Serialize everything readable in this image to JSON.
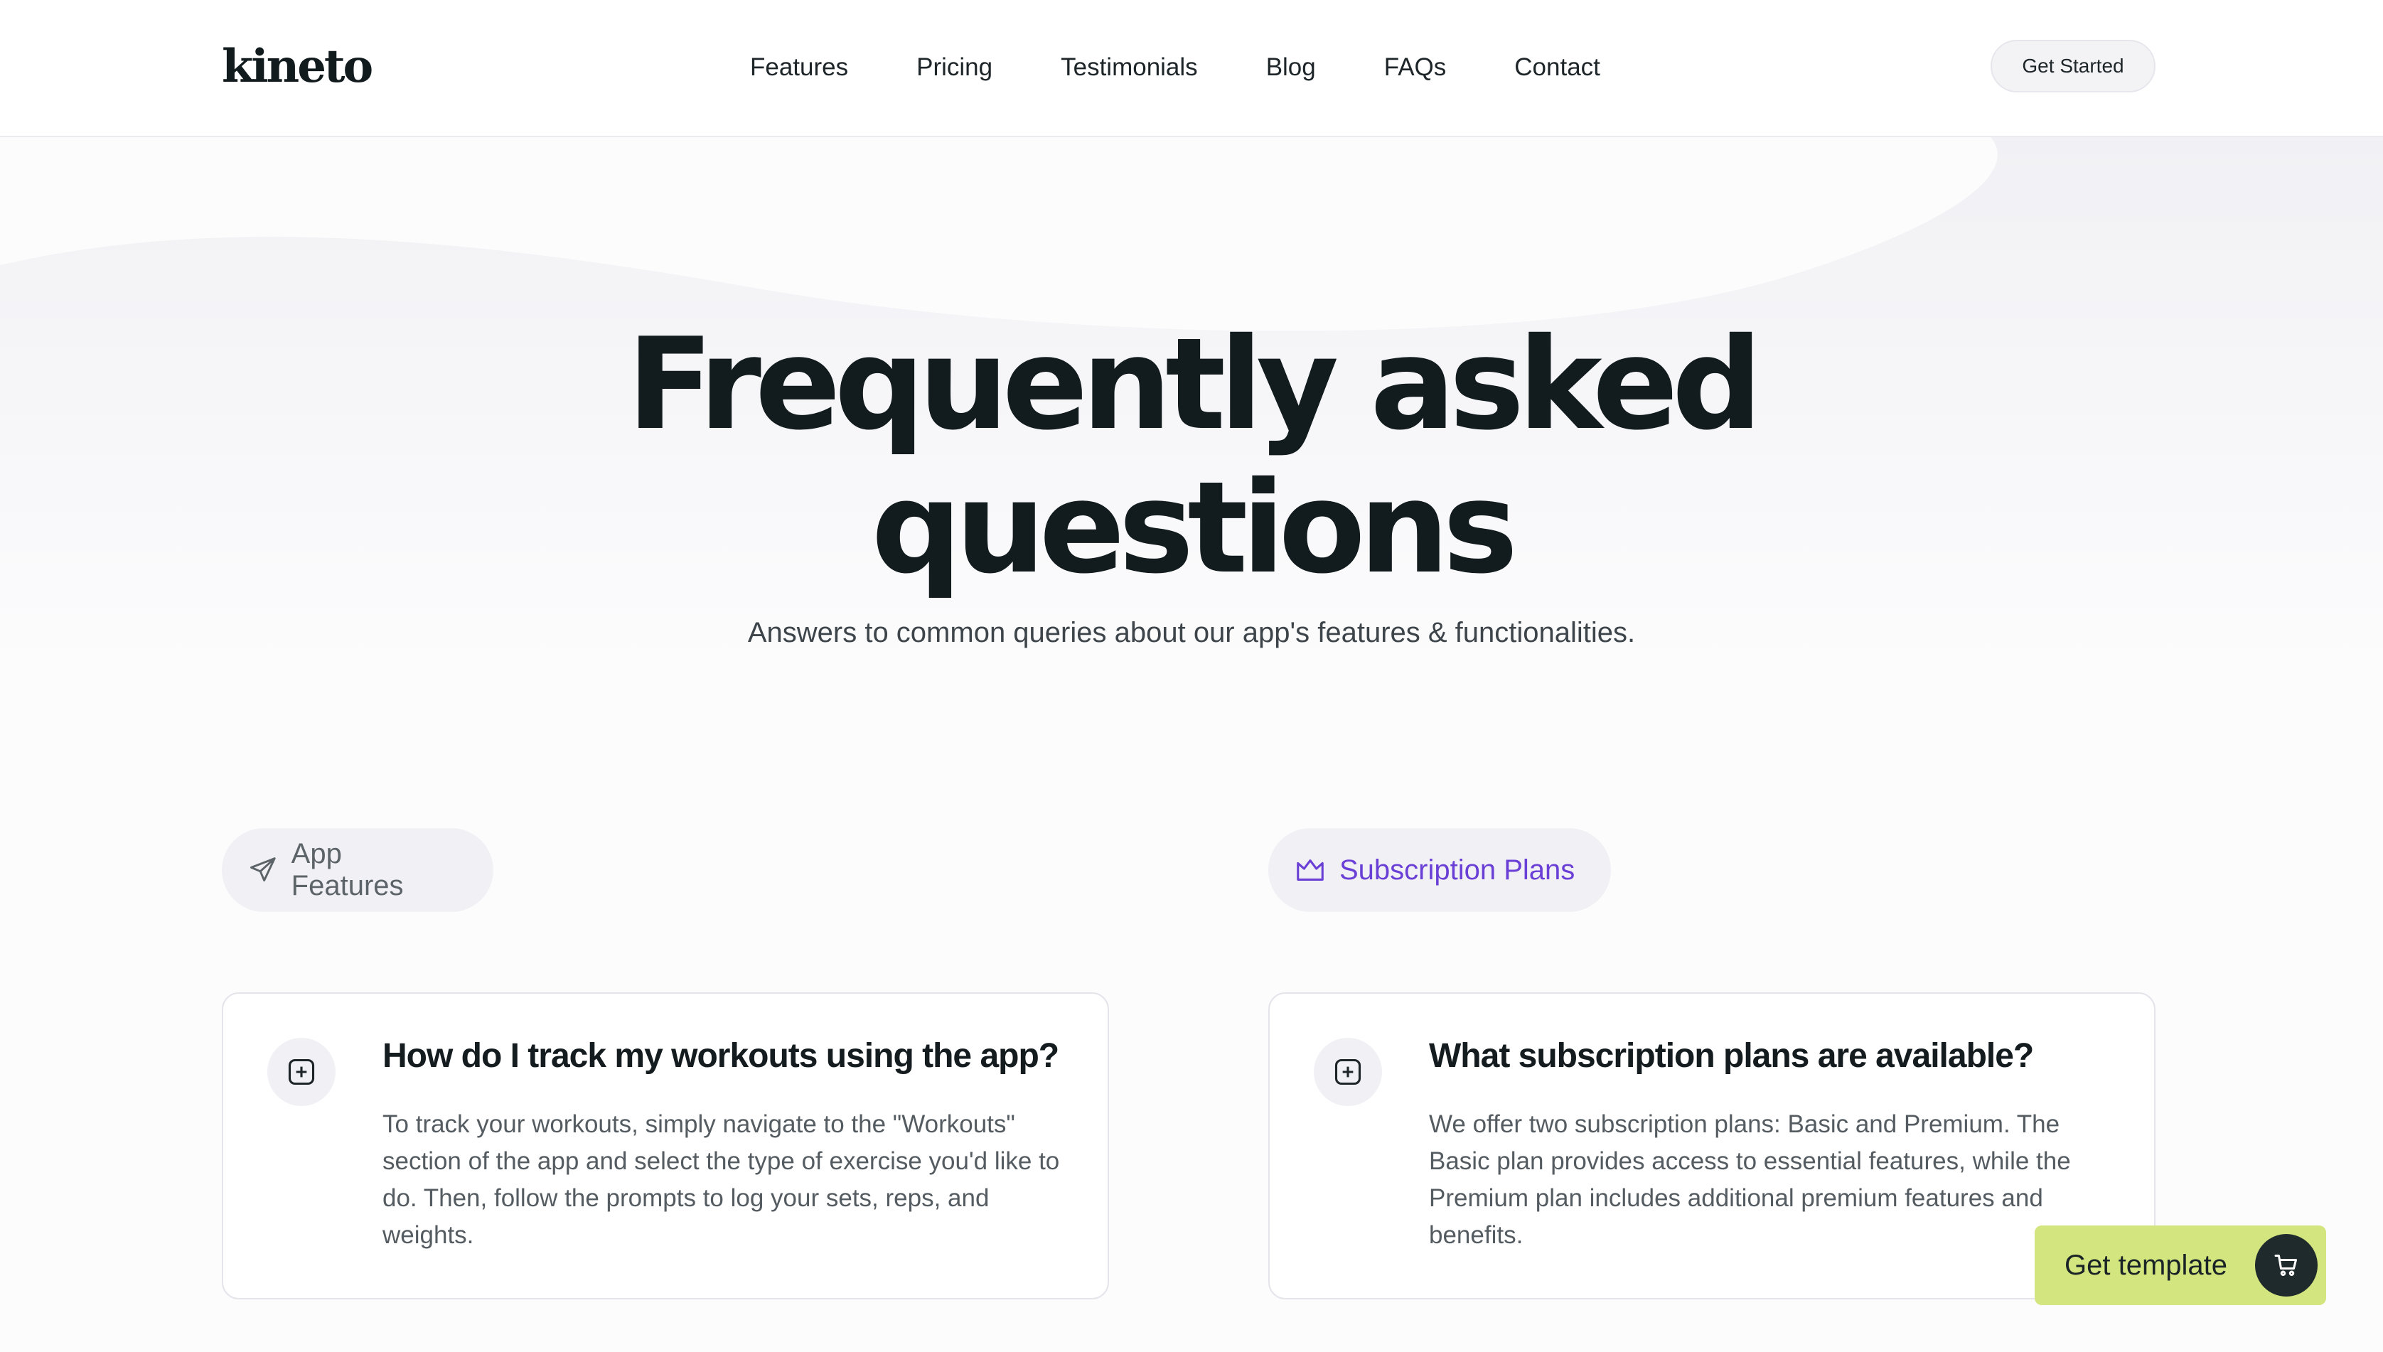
{
  "header": {
    "logo": "kineto",
    "nav": [
      "Features",
      "Pricing",
      "Testimonials",
      "Blog",
      "FAQs",
      "Contact"
    ],
    "cta_label": "Get Started"
  },
  "hero": {
    "title_line1": "Frequently asked",
    "title_line2": "questions",
    "subtitle": "Answers to common queries about our app's features & functionalities."
  },
  "categories": [
    {
      "label": "App Features",
      "icon": "paper-plane-icon",
      "active": false
    },
    {
      "label": "Subscription Plans",
      "icon": "crown-icon",
      "active": true
    }
  ],
  "faqs": [
    {
      "question": "How do I track my workouts using the app?",
      "answer": "To track your workouts, simply navigate to the \"Workouts\" section of the app and select the type of exercise you'd like to do. Then, follow the prompts to log your sets, reps, and weights.",
      "icon": "plus-square-icon"
    },
    {
      "question": "What subscription plans are available?",
      "answer": "We offer two subscription plans: Basic and Premium. The Basic plan provides access to essential features, while the Premium plan includes additional premium features and benefits.",
      "icon": "plus-square-icon"
    }
  ],
  "floating": {
    "label": "Get template",
    "icon": "cart-icon"
  },
  "colors": {
    "accent_purple": "#6a3fd6",
    "cta_green": "#d3e57e",
    "dark": "#121b1e"
  }
}
